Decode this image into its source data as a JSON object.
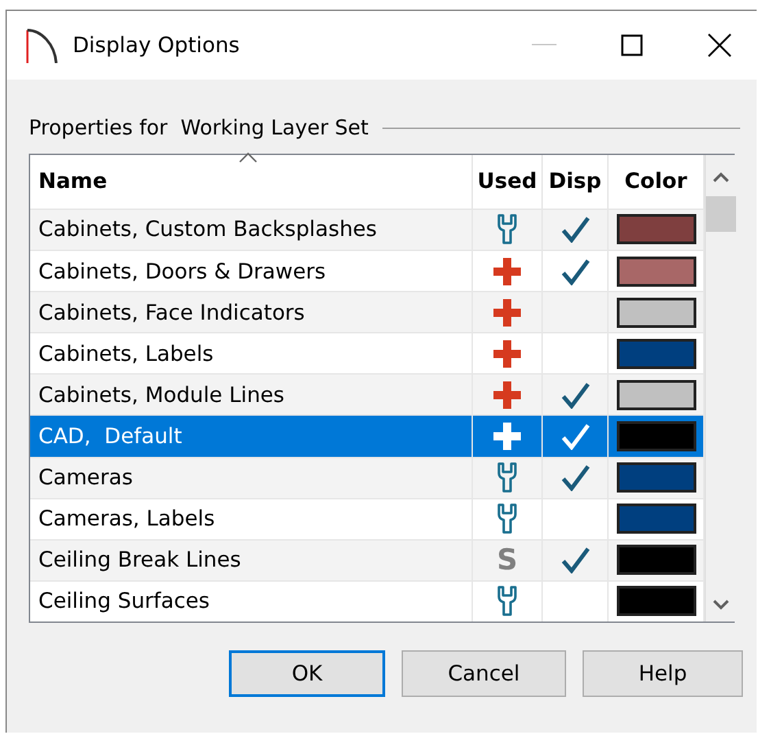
{
  "window": {
    "title": "Display Options"
  },
  "group": {
    "label": "Properties for  Working Layer Set"
  },
  "table": {
    "columns": [
      "Name",
      "Used",
      "Disp",
      "Color"
    ],
    "rows": [
      {
        "name": "Cabinets, Custom Backsplashes",
        "used": {
          "kind": "wrench"
        },
        "displayed": true,
        "color": "#7f3f3f",
        "selected": false
      },
      {
        "name": "Cabinets, Doors & Drawers",
        "used": {
          "kind": "plus"
        },
        "displayed": true,
        "color": "#a86767",
        "selected": false
      },
      {
        "name": "Cabinets, Face Indicators",
        "used": {
          "kind": "plus"
        },
        "displayed": false,
        "color": "#c0c0c0",
        "selected": false
      },
      {
        "name": "Cabinets, Labels",
        "used": {
          "kind": "plus"
        },
        "displayed": false,
        "color": "#003f7f",
        "selected": false
      },
      {
        "name": "Cabinets, Module Lines",
        "used": {
          "kind": "plus"
        },
        "displayed": true,
        "color": "#c0c0c0",
        "selected": false
      },
      {
        "name": "CAD,  Default",
        "used": {
          "kind": "plus"
        },
        "displayed": true,
        "color": "#000000",
        "selected": true
      },
      {
        "name": "Cameras",
        "used": {
          "kind": "wrench"
        },
        "displayed": true,
        "color": "#003f7f",
        "selected": false
      },
      {
        "name": "Cameras, Labels",
        "used": {
          "kind": "wrench"
        },
        "displayed": false,
        "color": "#003f7f",
        "selected": false
      },
      {
        "name": "Ceiling Break Lines",
        "used": {
          "kind": "letter",
          "text": "S"
        },
        "displayed": true,
        "color": "#000000",
        "selected": false
      },
      {
        "name": "Ceiling Surfaces",
        "used": {
          "kind": "wrench"
        },
        "displayed": false,
        "color": "#000000",
        "selected": false
      }
    ]
  },
  "buttons": [
    "OK",
    "Cancel",
    "Help"
  ]
}
